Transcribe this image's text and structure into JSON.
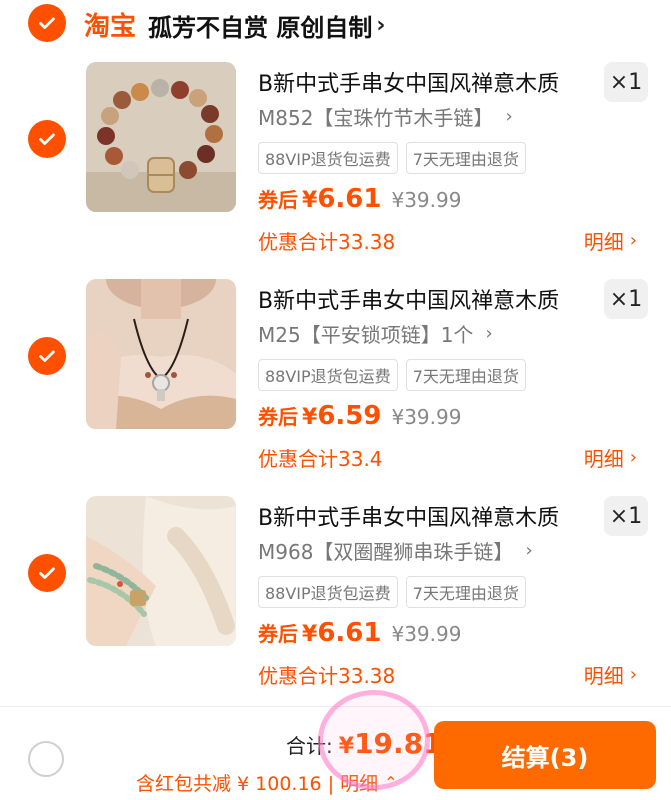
{
  "shop": {
    "logo_text": "淘宝",
    "name": "孤芳不自赏 原创自制",
    "chevron": "›"
  },
  "items": [
    {
      "title": "B新中式手串女中国风禅意木质",
      "qty": "×1",
      "sku": "M852【宝珠竹节木手链】",
      "tags": [
        "88VIP退货包运费",
        "7天无理由退货"
      ],
      "price_prefix": "券后",
      "price_currency": "¥",
      "price": "6.61",
      "original_price": "¥39.99",
      "discount": "优惠合计33.38",
      "detail": "明细"
    },
    {
      "title": "B新中式手串女中国风禅意木质",
      "qty": "×1",
      "sku": "M25【平安锁项链】1个",
      "tags": [
        "88VIP退货包运费",
        "7天无理由退货"
      ],
      "price_prefix": "券后",
      "price_currency": "¥",
      "price": "6.59",
      "original_price": "¥39.99",
      "discount": "优惠合计33.4",
      "detail": "明细"
    },
    {
      "title": "B新中式手串女中国风禅意木质",
      "qty": "×1",
      "sku": "M968【双圈醒狮串珠手链】",
      "tags": [
        "88VIP退货包运费",
        "7天无理由退货"
      ],
      "price_prefix": "券后",
      "price_currency": "¥",
      "price": "6.61",
      "original_price": "¥39.99",
      "discount": "优惠合计33.38",
      "detail": "明细"
    }
  ],
  "bottom": {
    "total_label": "合计:",
    "total_currency": "¥",
    "total": "19.81",
    "saving": "含红包共减 ¥ 100.16 | 明细",
    "checkout_label": "结算(3)"
  },
  "colors": {
    "accent": "#ff5000",
    "checkout": "#ff6a00",
    "highlight": "#ff9ad5"
  },
  "icons": [
    "check-icon",
    "chevron-right-icon",
    "radio-icon"
  ]
}
